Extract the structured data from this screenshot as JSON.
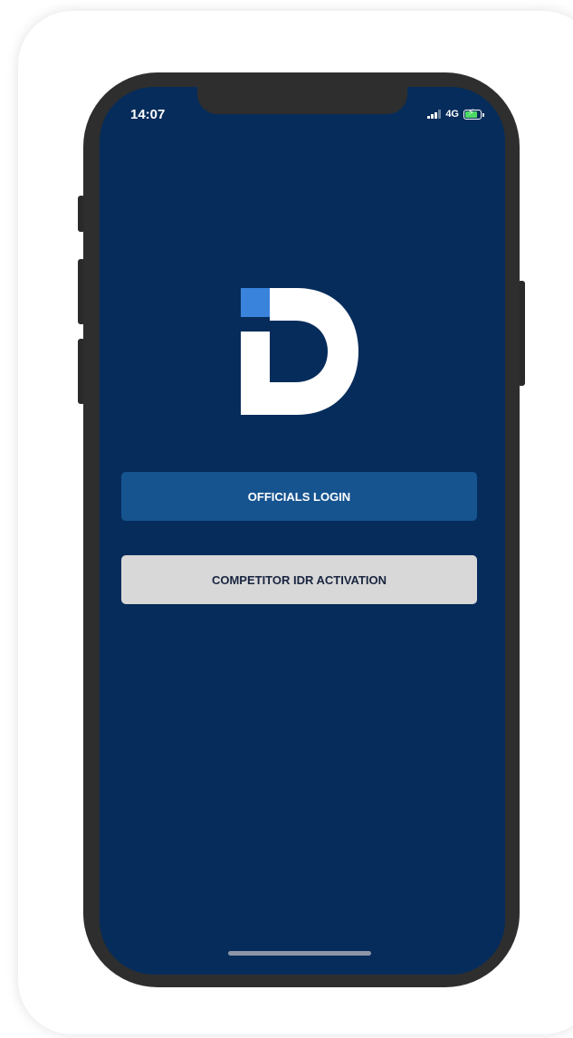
{
  "status_bar": {
    "time": "14:07",
    "network": "4G",
    "icons": [
      "signal-icon",
      "battery-charging-icon"
    ]
  },
  "logo": {
    "icon": "id-logo",
    "colors": {
      "square": "#3a83dc",
      "letters": "#ffffff"
    }
  },
  "buttons": {
    "officials_login": "OFFICIALS LOGIN",
    "competitor_activation": "COMPETITOR IDR ACTIVATION"
  },
  "colors": {
    "screen_background": "#052c5b",
    "primary_button": "#165490",
    "secondary_button": "#d8d8d8"
  }
}
